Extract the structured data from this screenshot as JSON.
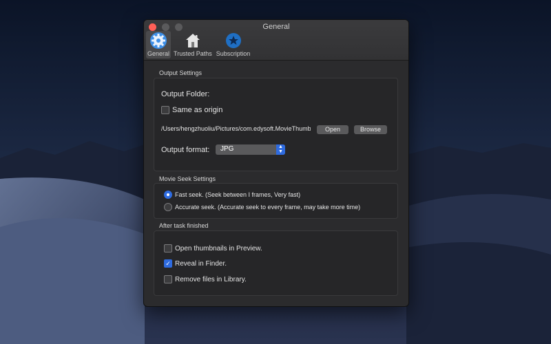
{
  "window": {
    "title": "General"
  },
  "tabs": [
    {
      "label": "General",
      "icon": "gear-icon",
      "active": true
    },
    {
      "label": "Trusted Paths",
      "icon": "house-icon",
      "active": false
    },
    {
      "label": "Subscription",
      "icon": "subscription-star-icon",
      "active": false
    }
  ],
  "output_settings": {
    "section_title": "Output Settings",
    "folder_label": "Output Folder:",
    "same_as_origin_label": "Same as origin",
    "same_as_origin_checked": false,
    "path_value": "/Users/hengzhuoliu/Pictures/com.edysoft.MovieThumb",
    "open_label": "Open",
    "browse_label": "Browse",
    "format_label": "Output format:",
    "format_value": "JPG"
  },
  "movie_seek": {
    "section_title": "Movie Seek Settings",
    "fast_label": "Fast seek. (Seek between I frames, Very fast)",
    "accurate_label": "Accurate seek. (Accurate seek to every frame, may take more time)",
    "selected": "fast"
  },
  "after_task": {
    "section_title": "After task finished",
    "open_preview_label": "Open thumbnails in Preview.",
    "open_preview_checked": false,
    "reveal_label": "Reveal in Finder.",
    "reveal_checked": true,
    "remove_label": "Remove files in Library.",
    "remove_checked": false
  },
  "colors": {
    "accent": "#2e6be0",
    "close_button": "#ff5f57",
    "window_bg": "#2b2b2d"
  }
}
